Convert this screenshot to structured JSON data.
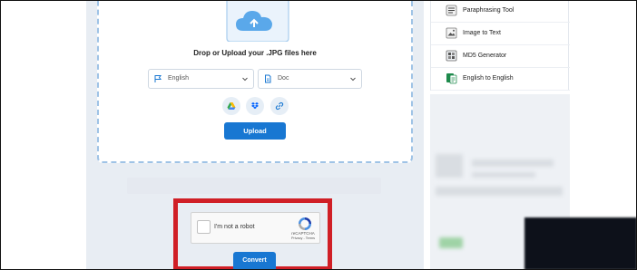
{
  "upload": {
    "drop_text": "Drop or Upload your .JPG files here",
    "language_value": "English",
    "output_format_value": "Doc",
    "upload_label": "Upload",
    "sources": [
      "google-drive",
      "dropbox",
      "url-link"
    ]
  },
  "captcha": {
    "label": "I'm not a robot",
    "brand": "reCAPTCHA",
    "terms": "Privacy - Terms"
  },
  "convert_label": "Convert",
  "tools": [
    {
      "label": "Paraphrasing Tool",
      "icon": "paraphrase-icon"
    },
    {
      "label": "Image to Text",
      "icon": "image-text-icon"
    },
    {
      "label": "MD5 Generator",
      "icon": "md5-icon"
    },
    {
      "label": "English to English",
      "icon": "translate-icon"
    }
  ],
  "colors": {
    "accent": "#1877d2",
    "highlight": "#d01f26",
    "page_bg": "#e8edf3"
  }
}
